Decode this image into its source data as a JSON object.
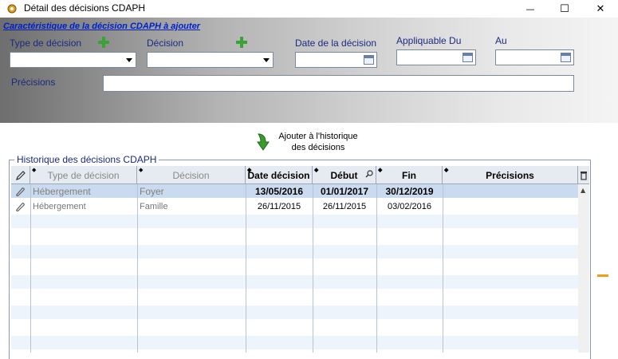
{
  "window": {
    "title": "Détail des décisions CDAPH",
    "minimize_glyph": "—",
    "maximize_glyph": "☐",
    "close_glyph": "✕"
  },
  "form": {
    "section_title": "Caractéristique de la décision CDAPH à ajouter",
    "type_label": "Type de décision",
    "type_value": "",
    "decision_label": "Décision",
    "decision_value": "",
    "date_label": "Date de la décision",
    "date_value": "",
    "applicable_from_label": "Appliquable Du",
    "applicable_from_value": "",
    "to_label": "Au",
    "to_value": "",
    "precisions_label": "Précisions",
    "precisions_value": ""
  },
  "add_button": {
    "line1": "Ajouter à l'historique",
    "line2": "des décisions"
  },
  "history": {
    "legend": "Historique des décisions CDAPH",
    "columns": [
      "Type de décision",
      "Décision",
      "Date décision",
      "Début",
      "Fin",
      "Précisions"
    ],
    "rows": [
      {
        "type": "Hébergement",
        "decision": "Foyer",
        "date": "13/05/2016",
        "start": "01/01/2017",
        "end": "30/12/2019",
        "precisions": ""
      },
      {
        "type": "Hébergement",
        "decision": "Famille",
        "date": "26/11/2015",
        "start": "26/11/2015",
        "end": "03/02/2016",
        "precisions": ""
      }
    ]
  },
  "colors": {
    "link": "#0020c8",
    "label": "#1b2a80",
    "selected_row": "#cbdbef",
    "alt_row": "#eef4fb",
    "accent_orange": "#f49b17",
    "plus_green": "#3aa335"
  },
  "icons": {
    "app": "gear-icon",
    "add_type": "plus-icon",
    "add_decision": "plus-icon",
    "calendar": "calendar-icon",
    "add_history": "down-arrow-icon",
    "edit_column": "pencil-icon",
    "row_attach": "paperclip-icon",
    "delete_column": "trash-icon"
  }
}
